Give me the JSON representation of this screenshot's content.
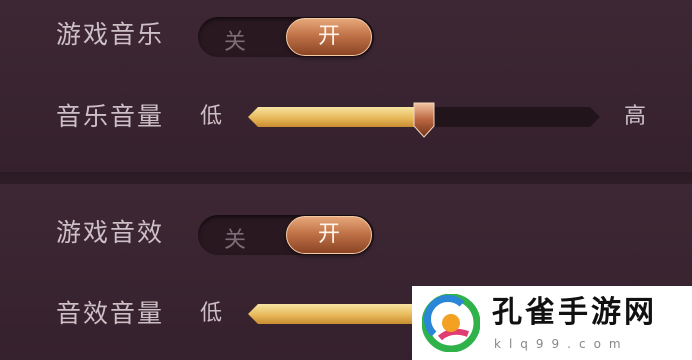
{
  "music": {
    "toggle_label": "游戏音乐",
    "off_label": "关",
    "on_label": "开",
    "state": "on",
    "volume_label": "音乐音量",
    "low_label": "低",
    "high_label": "高",
    "volume": 0.5
  },
  "sfx": {
    "toggle_label": "游戏音效",
    "off_label": "关",
    "on_label": "开",
    "state": "on",
    "volume_label": "音效音量",
    "low_label": "低"
  },
  "watermark": {
    "title": "孔雀手游网",
    "url": "klq99.com"
  },
  "colors": {
    "background": "#3a2531",
    "accent": "#c17348",
    "slider_fill": "#e7b95a"
  }
}
